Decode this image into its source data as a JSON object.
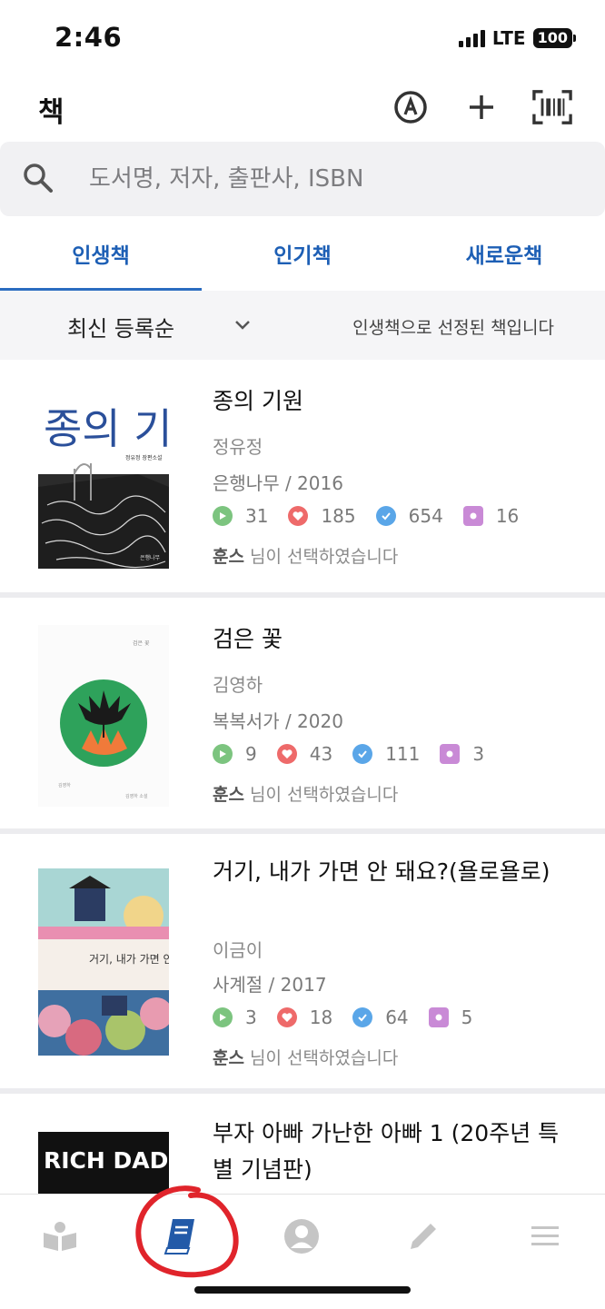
{
  "status_bar": {
    "time": "2:46",
    "network": "LTE",
    "battery": "100"
  },
  "header": {
    "title": "책"
  },
  "search": {
    "placeholder": "도서명, 저자, 출판사, ISBN"
  },
  "tabs": [
    {
      "label": "인생책",
      "active": true
    },
    {
      "label": "인기책",
      "active": false
    },
    {
      "label": "새로운책",
      "active": false
    }
  ],
  "filter": {
    "sort_label": "최신 등록순",
    "note": "인생책으로 선정된 책입니다"
  },
  "books": [
    {
      "title": "종의 기원",
      "author": "정유정",
      "publisher": "은행나무",
      "year": "2016",
      "pub_line": "은행나무  /  2016",
      "stats": {
        "play": "31",
        "heart": "185",
        "check": "654",
        "medal": "16"
      },
      "selected_user": "훈스",
      "selected_text": "님이 선택하였습니다",
      "cover": {
        "title_text": "종의 기원",
        "author_text": "정유정 장편소설",
        "publisher_text": "은행나무"
      }
    },
    {
      "title": "검은 꽃",
      "author": "김영하",
      "publisher": "복복서가",
      "year": "2020",
      "pub_line": "복복서가  /  2020",
      "stats": {
        "play": "9",
        "heart": "43",
        "check": "111",
        "medal": "3"
      },
      "selected_user": "훈스",
      "selected_text": "님이 선택하였습니다",
      "cover": {
        "title_text": "검은 꽃",
        "author_text": "김영하",
        "publisher_text": "김영하 소설"
      }
    },
    {
      "title": "거기, 내가 가면 안 돼요?(욜로욜로)",
      "author": "이금이",
      "publisher": "사계절",
      "year": "2017",
      "pub_line": "사계절  /  2017",
      "stats": {
        "play": "3",
        "heart": "18",
        "check": "64",
        "medal": "5"
      },
      "selected_user": "훈스",
      "selected_text": "님이 선택하였습니다",
      "cover": {
        "title_text": "거기, 내가 가면 안 돼요?"
      }
    },
    {
      "title": "부자 아빠 가난한 아빠 1 (20주년 특별 기념판)",
      "cover": {
        "title_text": "RICH DAD"
      }
    }
  ],
  "colors": {
    "accent": "#1d5fb5",
    "play": "#7cc47f",
    "heart": "#ee6a6a",
    "check": "#5aa6e8",
    "medal": "#c98ad6",
    "annotation": "#e0242b"
  },
  "bottom_nav": [
    "book-open-icon",
    "book-icon",
    "user-icon",
    "pencil-icon",
    "menu-icon"
  ]
}
